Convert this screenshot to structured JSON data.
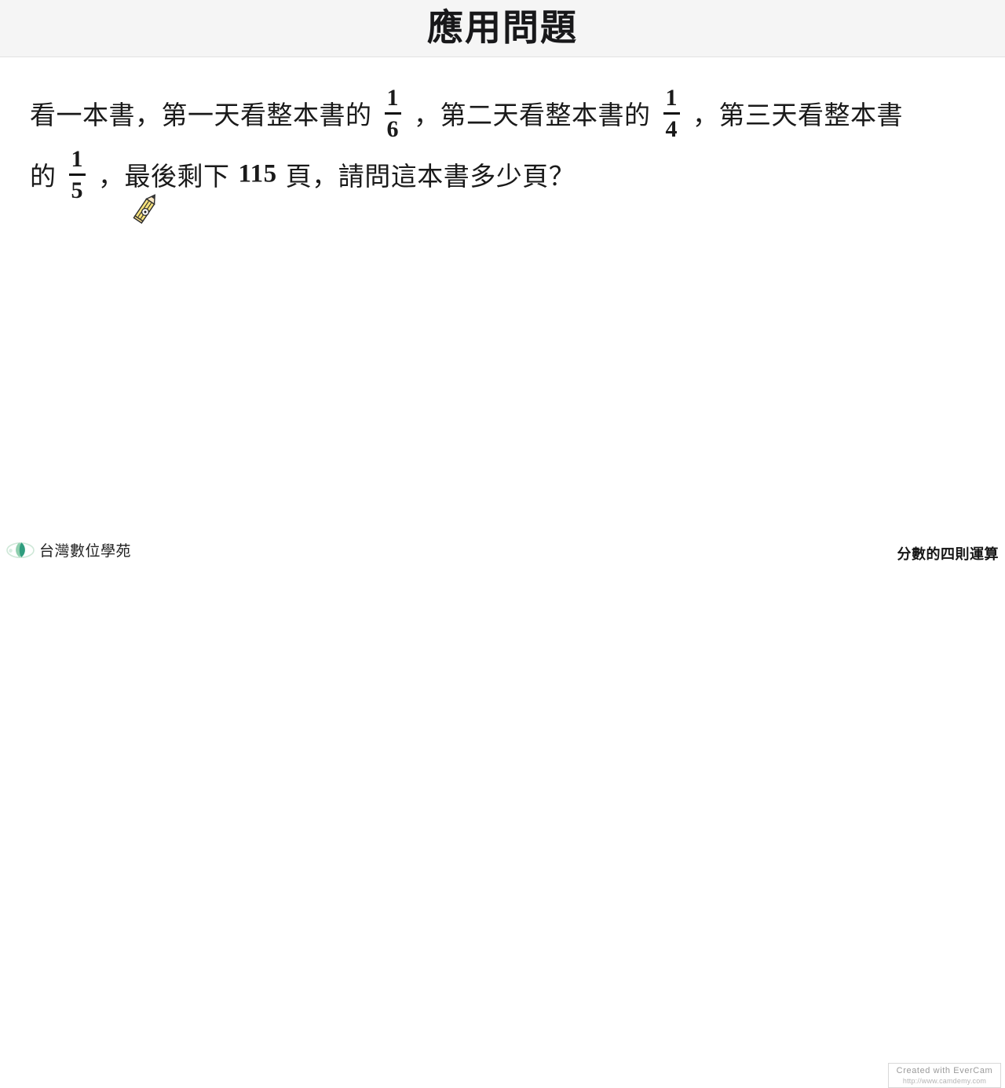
{
  "header": {
    "title": "應用問題",
    "background_color": "#f5f5f5",
    "text_color": "#18181a"
  },
  "problem": {
    "line1": {
      "seg1": "看一本書，第一天看整本書的",
      "frac1": {
        "numerator": "1",
        "denominator": "6"
      },
      "seg2": "，第二天看整本書的",
      "frac2": {
        "numerator": "1",
        "denominator": "4"
      },
      "seg3": "，第三天看整本書"
    },
    "line2": {
      "seg1": "的",
      "frac3": {
        "numerator": "1",
        "denominator": "5"
      },
      "seg2": "，最後剩下",
      "number": "115",
      "seg3": "頁，請問這本書多少頁？"
    },
    "full_text": "看一本書，第一天看整本書的 1/6，第二天看整本書的 1/4，第三天看整本書的 1/5，最後剩下 115 頁，請問這本書多少頁？",
    "text_color": "#1a1a1a"
  },
  "cursor": {
    "icon": "pencil-cursor",
    "body_color": "#f5e07a",
    "stripe_color": "#3a3a3a",
    "tip_color": "#f7dfb0",
    "lead_color": "#444444"
  },
  "footer": {
    "brand": "台灣數位學苑",
    "logo_icon": "leaf-logo-icon",
    "logo_colors": {
      "leaf_dark": "#2f9d7e",
      "leaf_light": "#9fd6b4",
      "ring": "#cfe8d8"
    },
    "topic": "分數的四則運算",
    "topic_color": "#161616"
  },
  "watermark": {
    "title": "Created with EverCam",
    "url": "http://www.camdemy.com",
    "text_color": "#9a9a9a",
    "border_color": "#d8d8d8"
  }
}
